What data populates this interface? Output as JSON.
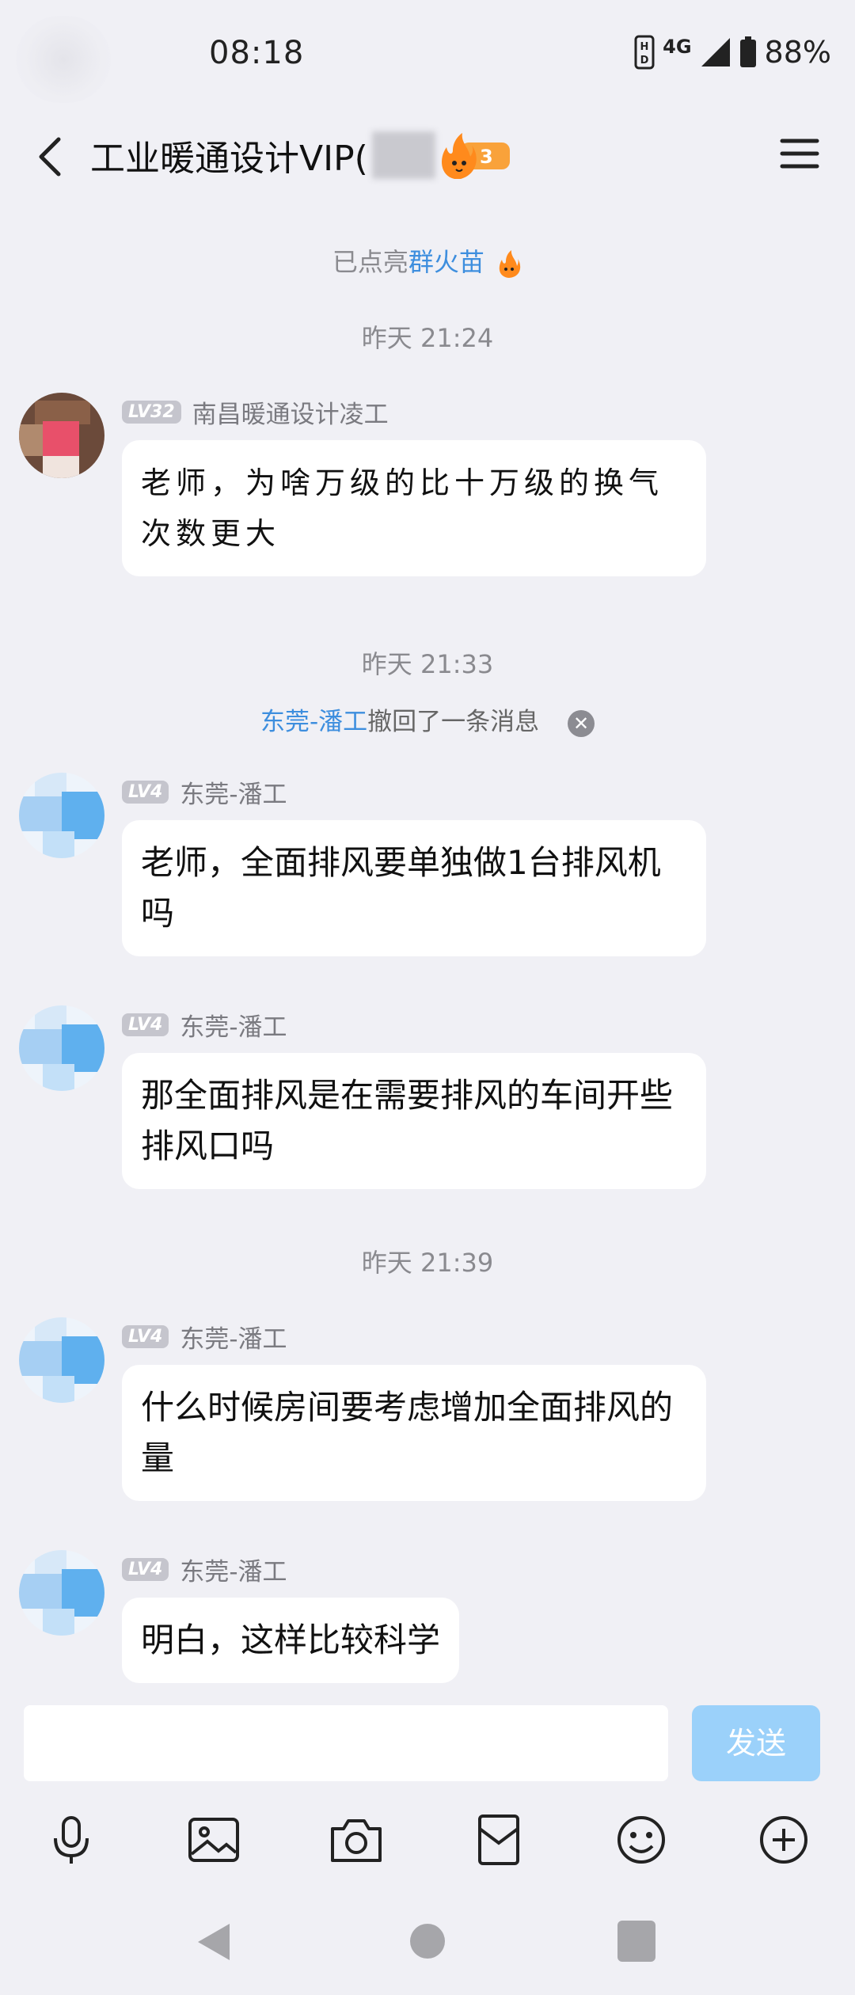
{
  "status_bar": {
    "time": "08:18",
    "network": "4G",
    "battery": "88%"
  },
  "header": {
    "title": "工业暖通设计VIP(",
    "flame_level": "3",
    "back_icon": "back-arrow-icon",
    "menu_icon": "hamburger-menu-icon"
  },
  "system_notice": {
    "prefix": "已点亮",
    "highlight": "群火苗"
  },
  "timestamps": [
    "昨天 21:24",
    "昨天 21:33",
    "昨天 21:39"
  ],
  "recall_notice": {
    "user": "东莞-潘工",
    "text": "撤回了一条消息"
  },
  "messages": [
    {
      "level": "LV32",
      "sender": "南昌暖通设计凌工",
      "text": "老师，为啥万级的比十万级的换气次数更大"
    },
    {
      "level": "LV4",
      "sender": "东莞-潘工",
      "text": "老师，全面排风要单独做1台排风机吗"
    },
    {
      "level": "LV4",
      "sender": "东莞-潘工",
      "text": "那全面排风是在需要排风的车间开些排风口吗"
    },
    {
      "level": "LV4",
      "sender": "东莞-潘工",
      "text": "什么时候房间要考虑增加全面排风的量"
    },
    {
      "level": "LV4",
      "sender": "东莞-潘工",
      "text": "明白，这样比较科学"
    }
  ],
  "input": {
    "placeholder": "",
    "send_label": "发送"
  },
  "toolbar": [
    "microphone-icon",
    "image-icon",
    "camera-icon",
    "red-packet-icon",
    "emoji-icon",
    "plus-icon"
  ],
  "colors": {
    "accent": "#3d8ede",
    "send_disabled": "#9bd1fa",
    "background": "#f0f0f5"
  }
}
